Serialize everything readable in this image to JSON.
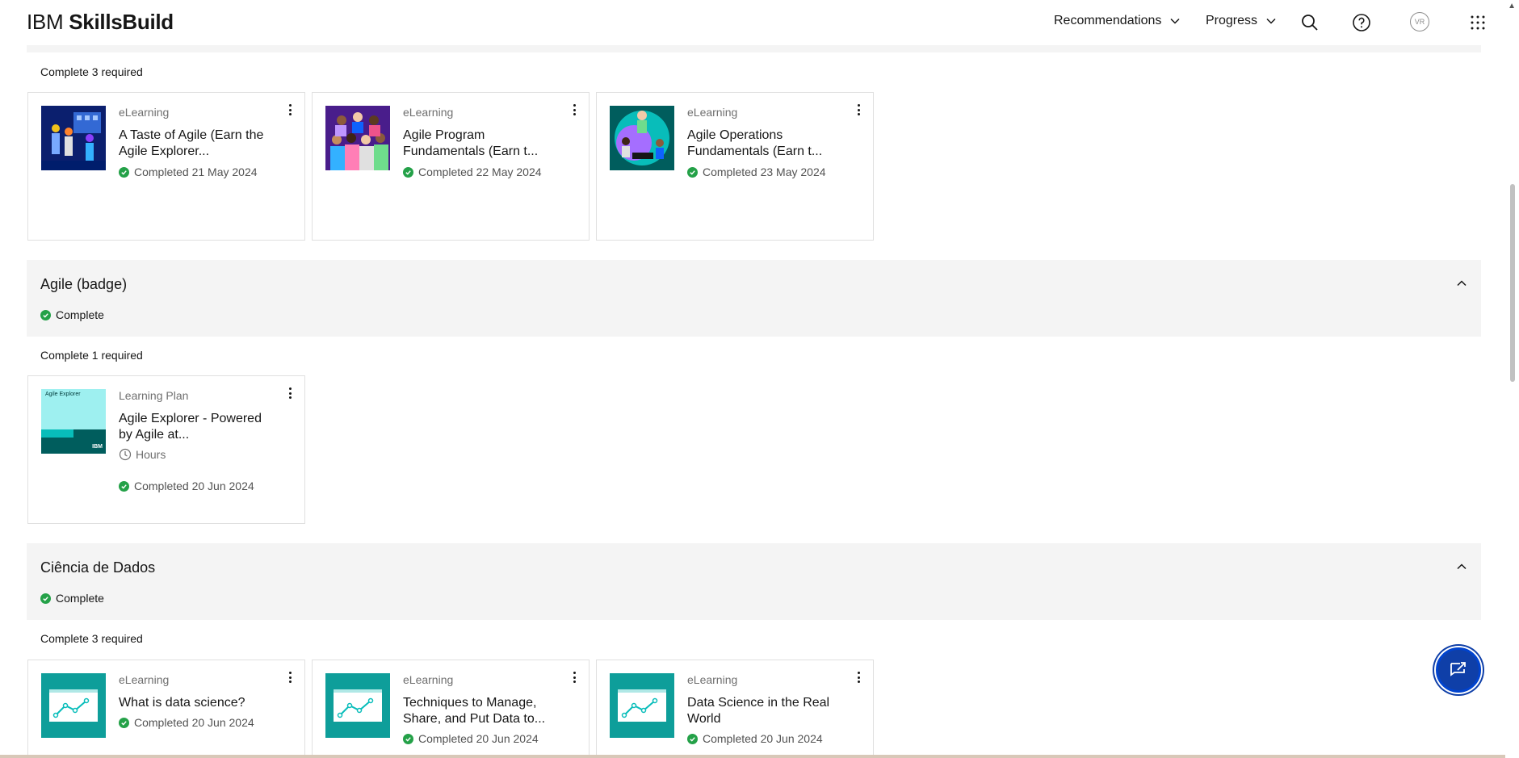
{
  "header": {
    "logo_ibm": "IBM",
    "logo_brand": "SkillsBuild",
    "nav": [
      {
        "label": "Recommendations"
      },
      {
        "label": "Progress"
      }
    ],
    "avatar_initials": "VR",
    "icons": [
      "search-icon",
      "help-icon",
      "app-switcher-icon"
    ]
  },
  "groups": [
    {
      "required": "Complete 3 required",
      "cards": [
        {
          "type": "eLearning",
          "title": "A Taste of Agile (Earn the Agile Explorer...",
          "status": "Completed 21 May 2024"
        },
        {
          "type": "eLearning",
          "title": "Agile Program Fundamentals (Earn t...",
          "status": "Completed 22 May 2024"
        },
        {
          "type": "eLearning",
          "title": "Agile Operations Fundamentals (Earn t...",
          "status": "Completed 23 May 2024"
        }
      ]
    },
    {
      "title": "Agile (badge)",
      "status": "Complete",
      "required": "Complete 1 required",
      "cards": [
        {
          "type": "Learning Plan",
          "title": "Agile Explorer - Powered by Agile at...",
          "duration": "Hours",
          "status": "Completed 20 Jun 2024",
          "thumb_text": "Agile Explorer",
          "thumb_logo": "IBM"
        }
      ]
    },
    {
      "title": "Ciência de Dados",
      "status": "Complete",
      "required": "Complete 3 required",
      "cards": [
        {
          "type": "eLearning",
          "title": "What is data science?",
          "status": "Completed 20 Jun 2024"
        },
        {
          "type": "eLearning",
          "title": "Techniques to Manage, Share, and Put Data to...",
          "status": "Completed 20 Jun 2024"
        },
        {
          "type": "eLearning",
          "title": "Data Science in the Real World",
          "status": "Completed 20 Jun 2024"
        }
      ]
    }
  ],
  "colors": {
    "accent": "#0f62fe",
    "success": "#24a148",
    "band": "#f4f4f4",
    "teal": "#0e9e9a"
  }
}
